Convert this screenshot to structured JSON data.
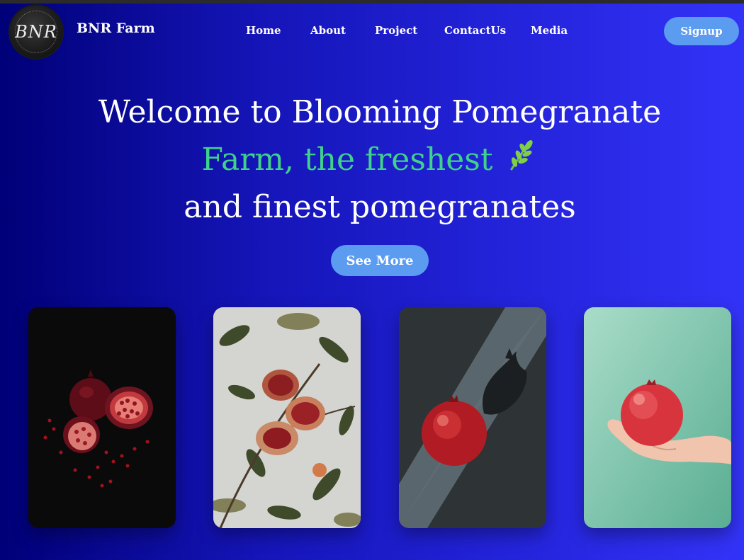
{
  "header": {
    "logo_text": "BNR",
    "brand": "BNR Farm",
    "nav": [
      {
        "label": "Home"
      },
      {
        "label": "About"
      },
      {
        "label": "Project"
      },
      {
        "label": "ContactUs"
      },
      {
        "label": "Media"
      }
    ],
    "signup_label": "Signup"
  },
  "hero": {
    "line1": "Welcome to Blooming Pomegranate",
    "line2": "Farm, the freshest",
    "line3": "and finest pomegranates",
    "leaf_icon": "leaf-icon",
    "see_more_label": "See More"
  },
  "colors": {
    "accent_button": "#5b9cf0",
    "highlight_text": "#3fd28a",
    "background_start": "#000078",
    "background_end": "#3333f8"
  },
  "gallery": [
    {
      "subject": "pomegranate halves with seeds on dark background"
    },
    {
      "subject": "open pomegranates on tree branches"
    },
    {
      "subject": "whole pomegranate with shadow"
    },
    {
      "subject": "pomegranate held in hand on mint background"
    }
  ]
}
